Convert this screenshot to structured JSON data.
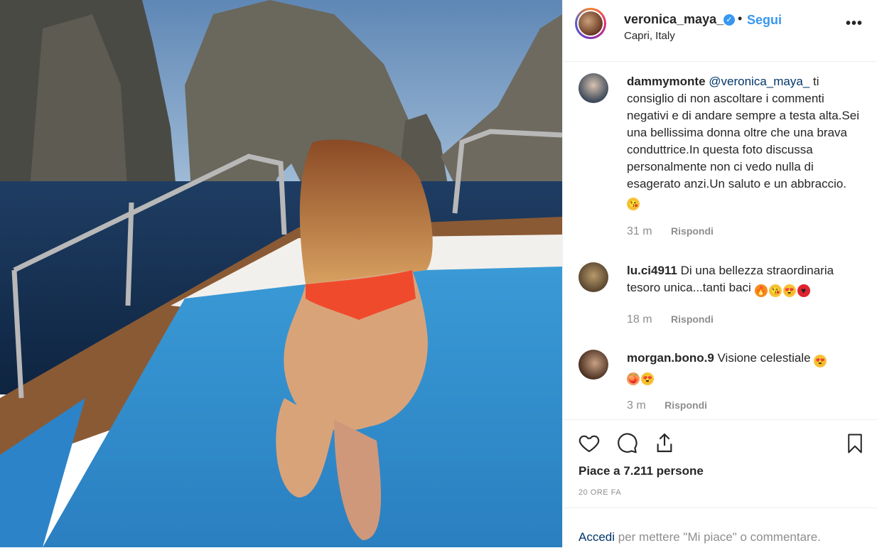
{
  "post": {
    "username": "veronica_maya_",
    "separator": "•",
    "follow_label": "Segui",
    "location": "Capri, Italy",
    "more_label": "•••"
  },
  "comments": [
    {
      "username": "dammymonte",
      "mention": "@veronica_maya_",
      "text": " ti consiglio di non ascoltare i commenti negativi e di andare sempre a testa alta.Sei una bellissima donna oltre che una brava conduttrice.In questa foto discussa personalmente non ci vedo nulla di esagerato anzi.Un saluto e un abbraccio. ",
      "emoji": [
        "kiss-face"
      ],
      "time": "31 m",
      "reply_label": "Rispondi"
    },
    {
      "username": "lu.ci4911",
      "text": " Di una bellezza straordinaria tesoro unica...tanti baci ",
      "emoji": [
        "fire",
        "kiss-face",
        "heart-eyes",
        "red-heart"
      ],
      "time": "18 m",
      "reply_label": "Rispondi"
    },
    {
      "username": "morgan.bono.9",
      "text": " Visione celestiale ",
      "emoji": [
        "heart-eyes",
        "peach",
        "heart-eyes"
      ],
      "time": "3 m",
      "reply_label": "Rispondi"
    }
  ],
  "actions": {
    "likes": "Piace a 7.211 persone",
    "posted_ago": "20 ORE FA",
    "icons": [
      "heart-icon",
      "comment-icon",
      "share-icon",
      "bookmark-icon"
    ]
  },
  "login": {
    "link": "Accedi",
    "text": " per mettere \"Mi piace\" o commentare."
  },
  "colors": {
    "accent": "#3897f0",
    "muted": "#8e8e8e",
    "link": "#003569"
  }
}
